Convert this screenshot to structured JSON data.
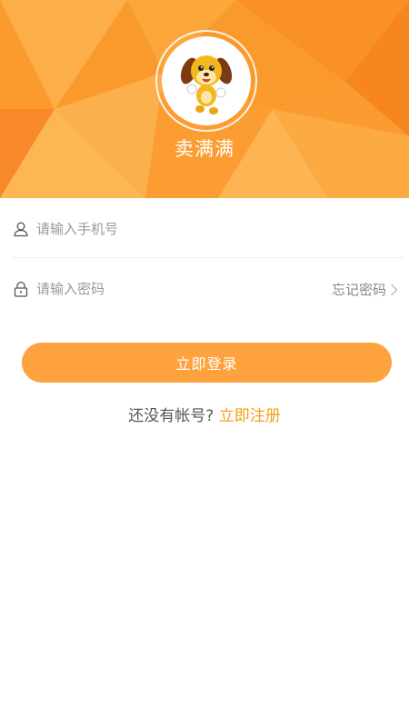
{
  "header": {
    "app_name": "卖满满",
    "colors": {
      "primary": "#fb9a2c",
      "light": "#fdb14a",
      "dark": "#f5841d"
    }
  },
  "avatar": {
    "icon": "dog-mascot-icon"
  },
  "form": {
    "phone": {
      "placeholder": "请输入手机号",
      "value": "",
      "icon": "user-icon"
    },
    "password": {
      "placeholder": "请输入密码",
      "value": "",
      "icon": "lock-icon"
    },
    "forgot_label": "忘记密码"
  },
  "login_button": {
    "label": "立即登录",
    "color": "#fda23d"
  },
  "register": {
    "prompt": "还没有帐号?",
    "link_label": "立即注册",
    "link_color": "#f2a01a"
  }
}
